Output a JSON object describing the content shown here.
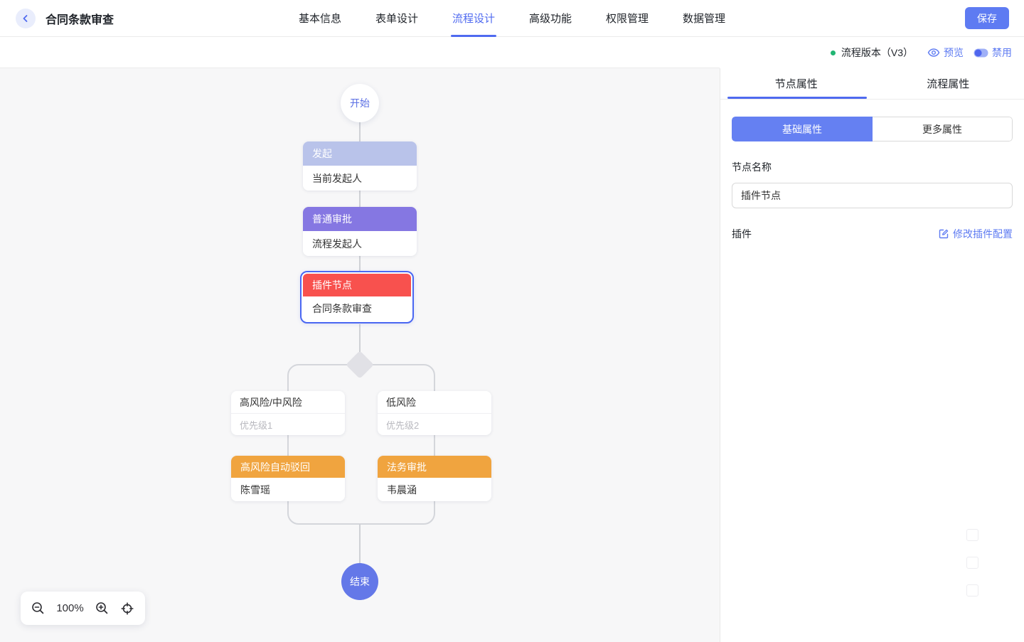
{
  "colors": {
    "accent": "#4f6af0",
    "link": "#5e7bf2",
    "save": "#5e7bf2",
    "seg": "#6580f2",
    "ninit": "#b9c3ea",
    "napprove": "#8577e2",
    "nplugin": "#f8514e",
    "naction": "#f0a43f",
    "nend": "#6478e8",
    "selborder": "#4a67f2",
    "line": "#cfd1d6",
    "canvas": "#f7f7f8",
    "gdot": "#21b573"
  },
  "header": {
    "title": "合同条款审查",
    "nav": [
      {
        "label": "基本信息"
      },
      {
        "label": "表单设计"
      },
      {
        "label": "流程设计"
      },
      {
        "label": "高级功能"
      },
      {
        "label": "权限管理"
      },
      {
        "label": "数据管理"
      }
    ],
    "save_label": "保存"
  },
  "toolbar": {
    "version_label": "流程版本（V3）",
    "preview_label": "预览",
    "disable_label": "禁用"
  },
  "flow": {
    "start_label": "开始",
    "end_label": "结束",
    "nodes": {
      "initiate": {
        "title": "发起",
        "body": "当前发起人"
      },
      "approval": {
        "title": "普通审批",
        "body": "流程发起人"
      },
      "plugin": {
        "title": "插件节点",
        "body": "合同条款审查"
      },
      "cond_left": {
        "title": "高风险/中风险",
        "priority": "优先级1"
      },
      "cond_right": {
        "title": "低风险",
        "priority": "优先级2"
      },
      "action_left": {
        "title": "高风险自动驳回",
        "body": "陈雪瑶"
      },
      "action_right": {
        "title": "法务审批",
        "body": "韦晨涵"
      }
    }
  },
  "zoom": {
    "level": "100%"
  },
  "panel": {
    "tabs": [
      {
        "label": "节点属性"
      },
      {
        "label": "流程属性"
      }
    ],
    "subtabs": [
      {
        "label": "基础属性"
      },
      {
        "label": "更多属性"
      }
    ],
    "node_name_label": "节点名称",
    "node_name_value": "插件节点",
    "plugin_label": "插件",
    "plugin_edit_label": "修改插件配置"
  }
}
